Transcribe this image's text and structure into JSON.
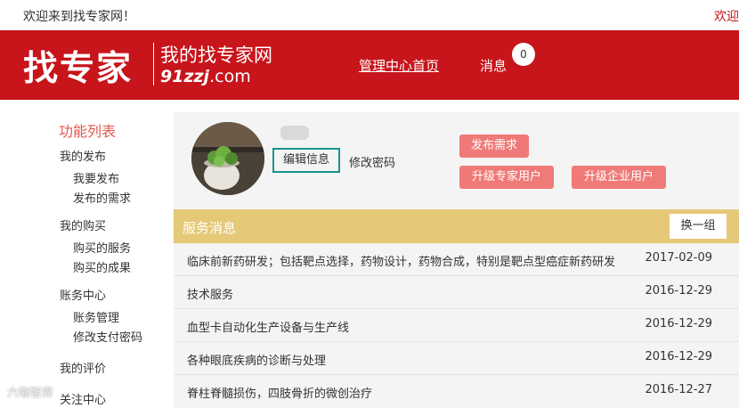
{
  "topbar": {
    "welcome": "欢迎来到找专家网！",
    "right_link": "欢迎"
  },
  "header": {
    "logo_main": "找专家",
    "logo_sub": "我的找专家网",
    "logo_domain_prefix": "91zzj",
    "logo_domain_suffix": ".com",
    "nav_home": "管理中心首页",
    "nav_messages": "消息",
    "message_count": "0",
    "brand_color": "#c8141b"
  },
  "sidebar": {
    "title": "功能列表",
    "groups": [
      {
        "label": "我的发布",
        "items": [
          "我要发布",
          "发布的需求"
        ]
      },
      {
        "label": "我的购买",
        "items": [
          "购买的服务",
          "购买的成果"
        ]
      },
      {
        "label": "账务中心",
        "items": [
          "账务管理",
          "修改支付密码"
        ]
      },
      {
        "label": "我的评价",
        "items": []
      },
      {
        "label": "关注中心",
        "items": []
      }
    ]
  },
  "profile": {
    "edit_info": "编辑信息",
    "change_password": "修改密码",
    "post_demand": "发布需求",
    "upgrade_expert": "升级专家用户",
    "upgrade_enterprise": "升级企业用户"
  },
  "services": {
    "title": "服务消息",
    "refresh": "换一组",
    "rows": [
      {
        "text": "临床前新药研发；包括靶点选择，药物设计，药物合成，特别是靶点型癌症新药研发",
        "date": "2017-02-09"
      },
      {
        "text": "技术服务",
        "date": "2016-12-29"
      },
      {
        "text": "血型卡自动化生产设备与生产线",
        "date": "2016-12-29"
      },
      {
        "text": "各种眼底疾病的诊断与处理",
        "date": "2016-12-29"
      },
      {
        "text": "脊柱脊髓损伤，四肢骨折的微创治疗",
        "date": "2016-12-27"
      }
    ]
  },
  "watermark": "六咖智库"
}
